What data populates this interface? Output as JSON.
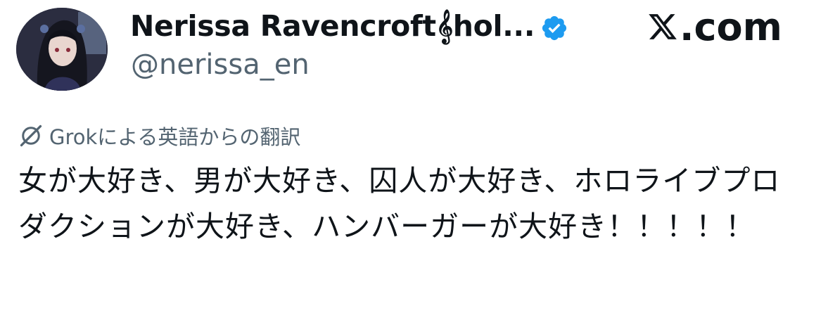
{
  "author": {
    "display_name": "Nerissa Ravencroft𝄞hol...",
    "handle": "@nerissa_en",
    "verified_icon": "verified-badge-icon",
    "avatar_icon": "avatar-image",
    "accent_color": "#1d9bf0"
  },
  "site": {
    "logo_icon": "x-logo-icon",
    "label": ".com"
  },
  "translation": {
    "icon": "grok-icon",
    "label": "Grokによる英語からの翻訳"
  },
  "tweet": {
    "text": "女が大好き、男が大好き、囚人が大好き、ホロライブプロダクションが大好き、ハンバーガーが大好き！！！！！"
  }
}
